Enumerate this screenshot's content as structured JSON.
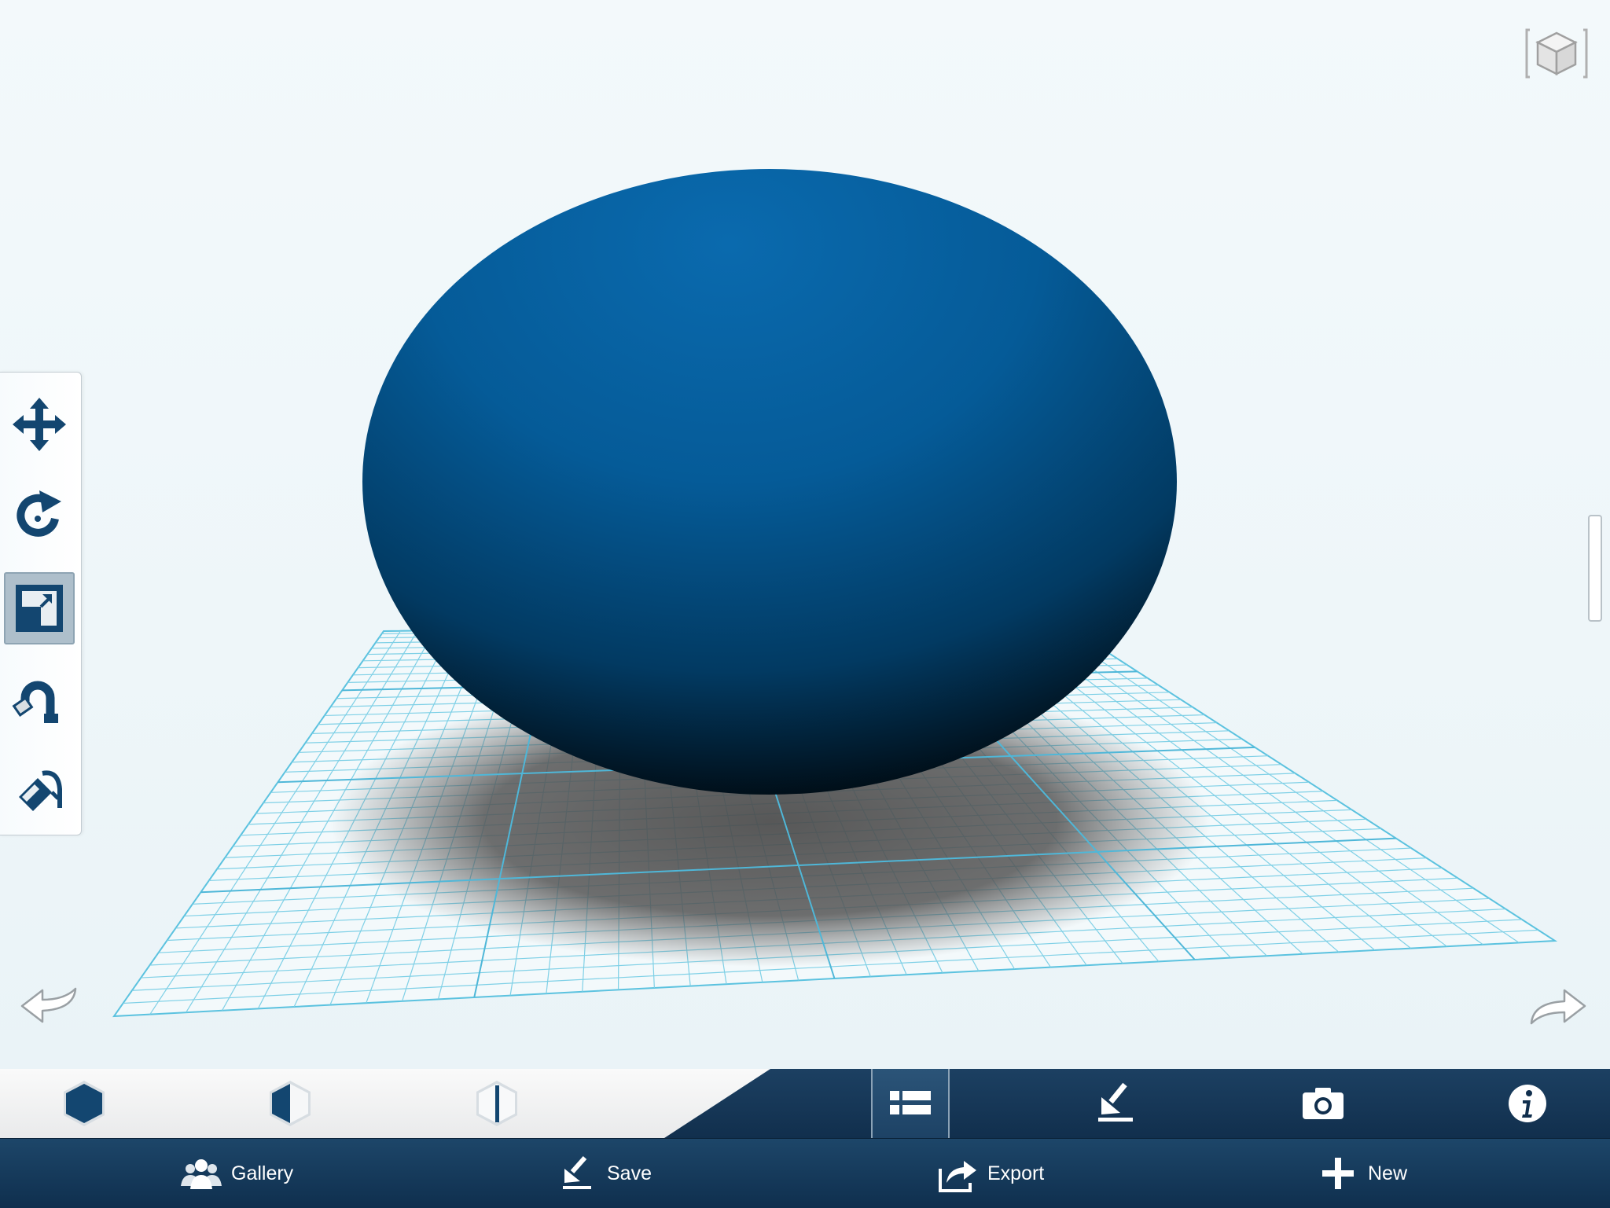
{
  "scene": {
    "object": "sphere",
    "object_color": "#0a6aae"
  },
  "tool_palette": {
    "tools": [
      {
        "name": "move",
        "icon": "move-arrows-icon",
        "active": false
      },
      {
        "name": "rotate",
        "icon": "rotate-icon",
        "active": false
      },
      {
        "name": "scale",
        "icon": "scale-icon",
        "active": true
      },
      {
        "name": "snap",
        "icon": "magnet-icon",
        "active": false
      },
      {
        "name": "paint",
        "icon": "paint-bucket-icon",
        "active": false
      }
    ]
  },
  "toolbar": {
    "materials": [
      "solid-material-icon",
      "half-transparent-material-icon",
      "transparent-material-icon"
    ],
    "actions": [
      {
        "icon": "list-icon",
        "selected": true
      },
      {
        "icon": "download-icon",
        "selected": false
      },
      {
        "icon": "camera-icon",
        "selected": false
      },
      {
        "icon": "info-icon",
        "selected": false
      }
    ]
  },
  "bottom_nav": {
    "gallery_label": "Gallery",
    "save_label": "Save",
    "export_label": "Export",
    "new_label": "New"
  },
  "colors": {
    "accent": "#134670",
    "grid": "#5bc2df",
    "toolbar_dark": "#112f4d"
  }
}
